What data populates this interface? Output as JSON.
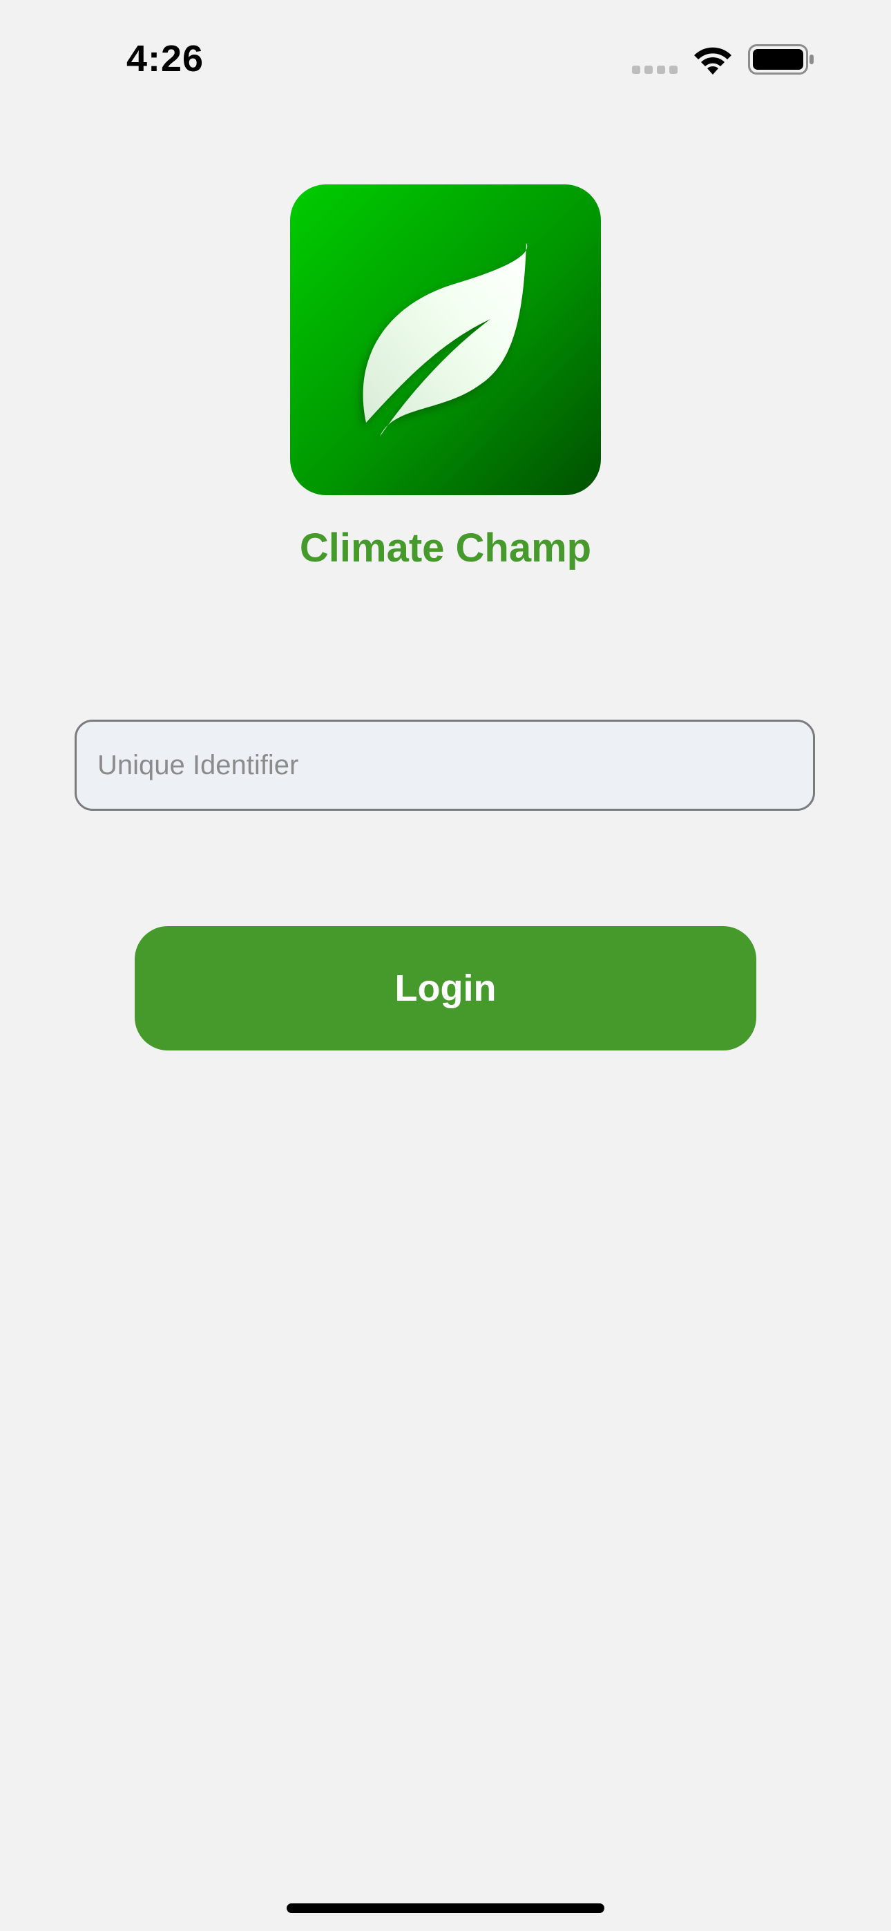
{
  "status_bar": {
    "time": "4:26",
    "icons": [
      "signal-icon",
      "wifi-icon",
      "battery-icon"
    ]
  },
  "logo": {
    "icon": "leaf-icon",
    "gradient_start": "#00cc00",
    "gradient_end": "#005000"
  },
  "app": {
    "title": "Climate Champ"
  },
  "login_form": {
    "identifier_placeholder": "Unique Identifier",
    "identifier_value": "",
    "login_label": "Login"
  },
  "colors": {
    "accent": "#459a2b",
    "background": "#f2f2f2",
    "input_background": "#edf0f4"
  }
}
